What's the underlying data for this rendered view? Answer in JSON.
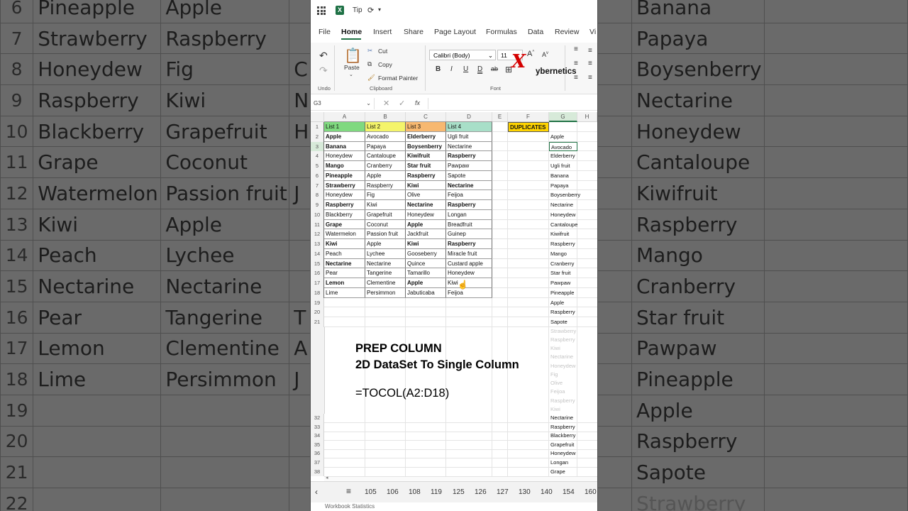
{
  "background_left": {
    "rows": [
      {
        "n": "6",
        "a": "Pineapple",
        "b": "Apple",
        "c": ""
      },
      {
        "n": "7",
        "a": "Strawberry",
        "b": "Raspberry",
        "c": ""
      },
      {
        "n": "8",
        "a": "Honeydew",
        "b": "Fig",
        "c": "C"
      },
      {
        "n": "9",
        "a": "Raspberry",
        "b": "Kiwi",
        "c": "N"
      },
      {
        "n": "10",
        "a": "Blackberry",
        "b": "Grapefruit",
        "c": "H"
      },
      {
        "n": "11",
        "a": "Grape",
        "b": "Coconut",
        "c": ""
      },
      {
        "n": "12",
        "a": "Watermelon",
        "b": "Passion fruit",
        "c": "J"
      },
      {
        "n": "13",
        "a": "Kiwi",
        "b": "Apple",
        "c": ""
      },
      {
        "n": "14",
        "a": "Peach",
        "b": "Lychee",
        "c": ""
      },
      {
        "n": "15",
        "a": "Nectarine",
        "b": "Nectarine",
        "c": ""
      },
      {
        "n": "16",
        "a": "Pear",
        "b": "Tangerine",
        "c": "T"
      },
      {
        "n": "17",
        "a": "Lemon",
        "b": "Clementine",
        "c": "A"
      },
      {
        "n": "18",
        "a": "Lime",
        "b": "Persimmon",
        "c": "J"
      },
      {
        "n": "19",
        "a": "",
        "b": "",
        "c": ""
      },
      {
        "n": "20",
        "a": "",
        "b": "",
        "c": ""
      },
      {
        "n": "21",
        "a": "",
        "b": "",
        "c": ""
      },
      {
        "n": "22",
        "a": "",
        "b": "",
        "c": ""
      }
    ]
  },
  "background_right": {
    "rows": [
      "Banana",
      "Papaya",
      "Boysenberry",
      "Nectarine",
      "Honeydew",
      "Cantaloupe",
      "Kiwifruit",
      "Raspberry",
      "Mango",
      "Cranberry",
      "Star fruit",
      "Pawpaw",
      "Pineapple",
      "Apple",
      "Raspberry",
      "Sapote",
      "Strawberry"
    ]
  },
  "titlebar": {
    "doc_title": "Tip",
    "sync_icon": "sync-icon",
    "dropdown_icon": "chevron-down-icon"
  },
  "menu_tabs": [
    "File",
    "Home",
    "Insert",
    "Share",
    "Page Layout",
    "Formulas",
    "Data",
    "Review",
    "Vi"
  ],
  "active_tab": "Home",
  "ribbon": {
    "undo_label": "Undo",
    "paste_label": "Paste",
    "cut_label": "Cut",
    "copy_label": "Copy",
    "format_painter_label": "Format Painter",
    "clipboard_group": "Clipboard",
    "font_name": "Calibri (Body)",
    "font_size": "11",
    "font_group": "Font",
    "bold": "B",
    "italic": "I",
    "underline": "U",
    "double_underline": "D",
    "strike": "ab"
  },
  "watermark": {
    "x": "X",
    "text": "ybernetics"
  },
  "formula_bar": {
    "name_box": "G3",
    "fx": "fx"
  },
  "columns": [
    "A",
    "B",
    "C",
    "D",
    "E",
    "F",
    "G",
    "H"
  ],
  "table_headers": [
    "List 1",
    "List 2",
    "List 3",
    "List 4"
  ],
  "table_header_colors": [
    "#7fd97f",
    "#f4f46a",
    "#f7b870",
    "#a8dfc8"
  ],
  "table_rows": [
    [
      "Apple",
      "Avocado",
      "Elderberry",
      "Ugli fruit"
    ],
    [
      "Banana",
      "Papaya",
      "Boysenberry",
      "Nectarine"
    ],
    [
      "Honeydew",
      "Cantaloupe",
      "Kiwifruit",
      "Raspberry"
    ],
    [
      "Mango",
      "Cranberry",
      "Star fruit",
      "Pawpaw"
    ],
    [
      "Pineapple",
      "Apple",
      "Raspberry",
      "Sapote"
    ],
    [
      "Strawberry",
      "Raspberry",
      "Kiwi",
      "Nectarine"
    ],
    [
      "Honeydew",
      "Fig",
      "Olive",
      "Feijoa"
    ],
    [
      "Raspberry",
      "Kiwi",
      "Nectarine",
      "Raspberry"
    ],
    [
      "Blackberry",
      "Grapefruit",
      "Honeydew",
      "Longan"
    ],
    [
      "Grape",
      "Coconut",
      "Apple",
      "Breadfruit"
    ],
    [
      "Watermelon",
      "Passion fruit",
      "Jackfruit",
      "Guinep"
    ],
    [
      "Kiwi",
      "Apple",
      "Kiwi",
      "Raspberry"
    ],
    [
      "Peach",
      "Lychee",
      "Gooseberry",
      "Miracle fruit"
    ],
    [
      "Nectarine",
      "Nectarine",
      "Quince",
      "Custard apple"
    ],
    [
      "Pear",
      "Tangerine",
      "Tamarillo",
      "Honeydew"
    ],
    [
      "Lemon",
      "Clementine",
      "Apple",
      "Kiwi"
    ],
    [
      "Lime",
      "Persimmon",
      "Jabuticaba",
      "Feijoa"
    ]
  ],
  "bold_cells": [
    [
      0,
      0
    ],
    [
      1,
      0
    ],
    [
      3,
      0
    ],
    [
      4,
      0
    ],
    [
      5,
      0
    ],
    [
      7,
      0
    ],
    [
      9,
      0
    ],
    [
      11,
      0
    ],
    [
      13,
      0
    ],
    [
      15,
      0
    ],
    [
      0,
      2
    ],
    [
      1,
      2
    ],
    [
      2,
      2
    ],
    [
      3,
      2
    ],
    [
      4,
      2
    ],
    [
      5,
      2
    ],
    [
      7,
      2
    ],
    [
      9,
      2
    ],
    [
      11,
      2
    ],
    [
      15,
      2
    ],
    [
      2,
      3
    ],
    [
      5,
      3
    ],
    [
      7,
      3
    ],
    [
      11,
      3
    ]
  ],
  "duplicates_label": "DUPLICATES",
  "duplicates_color": "#ffd400",
  "g_column": [
    "Apple",
    "Avocado",
    "Elderberry",
    "Ugli fruit",
    "Banana",
    "Papaya",
    "Boysenberry",
    "Nectarine",
    "Honeydew",
    "Cantaloupe",
    "Kiwifruit",
    "Raspberry",
    "Mango",
    "Cranberry",
    "Star fruit",
    "Pawpaw",
    "Pineapple",
    "Apple",
    "Raspberry",
    "Sapote"
  ],
  "g_column_faded": [
    "Strawberry",
    "Raspberry",
    "Kiwi",
    "Nectarine",
    "Honeydew",
    "Fig",
    "Olive",
    "Feijoa",
    "Raspberry",
    "Kiwi"
  ],
  "g_column_lower": [
    "Nectarine",
    "Raspberry",
    "Blackberry",
    "Grapefruit",
    "Honeydew",
    "Longan",
    "Grape"
  ],
  "row_numbers_top": [
    "1",
    "2",
    "3",
    "4",
    "5",
    "6",
    "7",
    "8",
    "9",
    "10",
    "11",
    "12",
    "13",
    "14",
    "15",
    "16",
    "17",
    "18",
    "19",
    "20",
    "21"
  ],
  "row_numbers_bottom": [
    "32",
    "33",
    "34",
    "35",
    "36",
    "37",
    "38"
  ],
  "overlay": {
    "line1": "PREP COLUMN",
    "line2": "2D DataSet To Single Column",
    "formula": "=TOCOL(A2:D18)"
  },
  "sheet_tabs": [
    "105",
    "106",
    "108",
    "119",
    "125",
    "126",
    "127",
    "130",
    "140",
    "154",
    "160"
  ],
  "status_text": "Workbook Statistics"
}
